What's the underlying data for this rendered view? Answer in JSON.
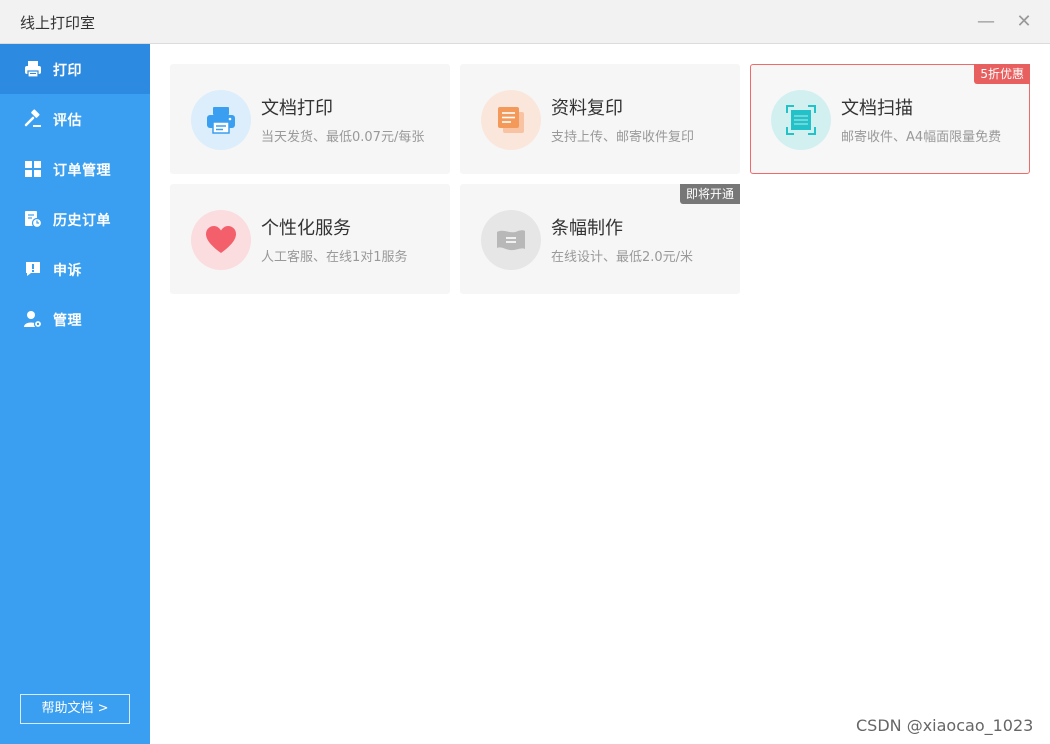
{
  "window": {
    "title": "线上打印室",
    "minimize_glyph": "—",
    "close_glyph": "✕"
  },
  "sidebar": {
    "items": [
      {
        "label": "打印",
        "icon": "printer-icon",
        "active": true
      },
      {
        "label": "评估",
        "icon": "gavel-icon",
        "active": false
      },
      {
        "label": "订单管理",
        "icon": "grid-icon",
        "active": false
      },
      {
        "label": "历史订单",
        "icon": "history-icon",
        "active": false
      },
      {
        "label": "申诉",
        "icon": "alert-icon",
        "active": false
      },
      {
        "label": "管理",
        "icon": "user-settings-icon",
        "active": false
      }
    ],
    "help_label": "帮助文档 >"
  },
  "services": [
    {
      "title": "文档打印",
      "desc": "当天发货、最低0.07元/每张",
      "icon": "printer-icon",
      "color": "#3a9ff0",
      "bg": "#dcedfb",
      "badge": ""
    },
    {
      "title": "资料复印",
      "desc": "支持上传、邮寄收件复印",
      "icon": "copy-icon",
      "color": "#f39a5a",
      "bg": "#fbe6dc",
      "badge": ""
    },
    {
      "title": "文档扫描",
      "desc": "邮寄收件、A4幅面限量免费",
      "icon": "scan-icon",
      "color": "#22c2c8",
      "bg": "#d3f0f1",
      "badge": "5折优惠"
    },
    {
      "title": "个性化服务",
      "desc": "人工客服、在线1对1服务",
      "icon": "heart-icon",
      "color": "#f35f6a",
      "bg": "#fbdcdf",
      "badge": ""
    },
    {
      "title": "条幅制作",
      "desc": "在线设计、最低2.0元/米",
      "icon": "banner-icon",
      "color": "#b8b8b8",
      "bg": "#e6e6e6",
      "badge": "即将开通"
    }
  ],
  "watermark": "CSDN @xiaocao_1023",
  "colors": {
    "sidebar": "#3a9ff0",
    "sidebar_active": "#2c8ae0",
    "badge_red": "#e85f5f",
    "badge_gray": "#777777"
  }
}
